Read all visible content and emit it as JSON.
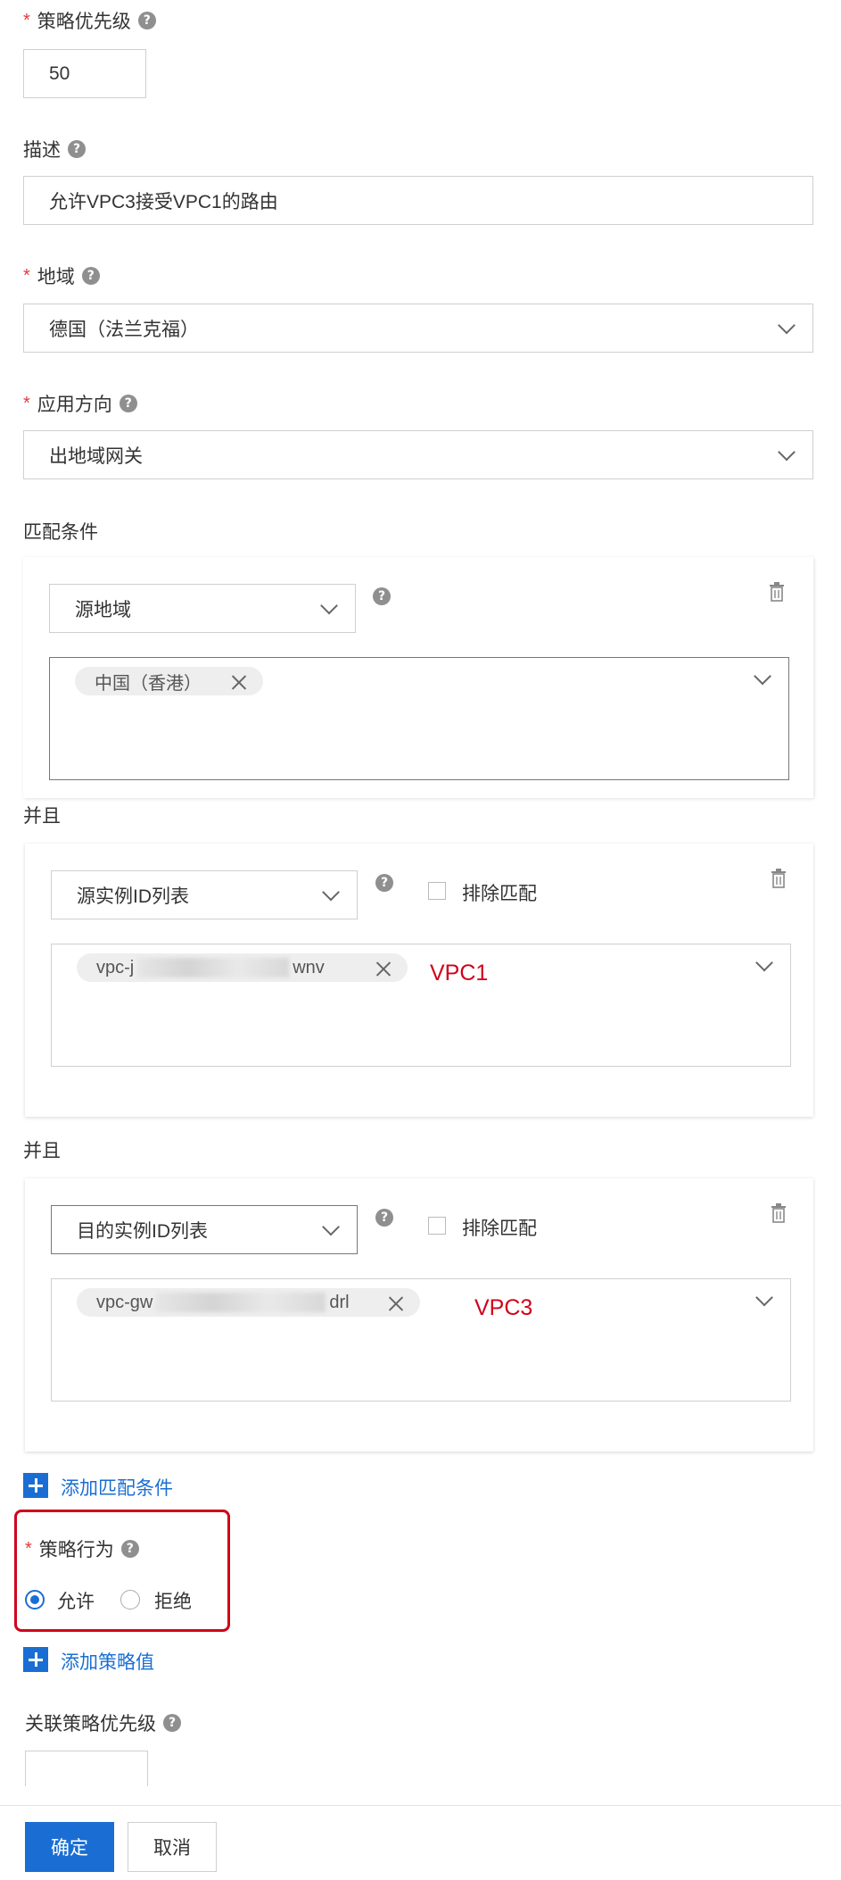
{
  "priority": {
    "label": "策略优先级",
    "value": "50"
  },
  "description": {
    "label": "描述",
    "value": "允许VPC3接受VPC1的路由"
  },
  "region": {
    "label": "地域",
    "value": "德国（法兰克福）"
  },
  "direction": {
    "label": "应用方向",
    "value": "出地域网关"
  },
  "match": {
    "label": "匹配条件",
    "and_label": "并且",
    "conditions": [
      {
        "type": "源地域",
        "tags": [
          "中国（香港）"
        ]
      },
      {
        "type": "源实例ID列表",
        "exclude_label": "排除匹配",
        "tag_prefix": "vpc-j",
        "tag_suffix": "wnv",
        "annotation": "VPC1"
      },
      {
        "type": "目的实例ID列表",
        "exclude_label": "排除匹配",
        "tag_prefix": "vpc-gw",
        "tag_suffix": "drl",
        "annotation": "VPC3"
      }
    ],
    "add_label": "添加匹配条件"
  },
  "action": {
    "label": "策略行为",
    "options": [
      {
        "label": "允许",
        "selected": true
      },
      {
        "label": "拒绝",
        "selected": false
      }
    ],
    "highlight_color": "#d0021b"
  },
  "add_value_label": "添加策略值",
  "assoc_priority": {
    "label": "关联策略优先级",
    "value": ""
  },
  "footer": {
    "confirm": "确定",
    "cancel": "取消"
  },
  "colors": {
    "accent": "#1a6ed3",
    "required": "#e4393c",
    "annotation": "#d0021b"
  }
}
